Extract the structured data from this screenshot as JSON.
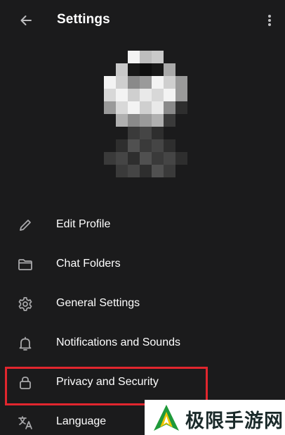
{
  "header": {
    "title": "Settings",
    "back_icon": "back-arrow-icon",
    "more_icon": "more-vertical-icon"
  },
  "profile": {
    "avatar": "pixelated-avatar"
  },
  "menu": {
    "items": [
      {
        "label": "Edit Profile",
        "icon": "pencil-icon"
      },
      {
        "label": "Chat Folders",
        "icon": "folder-icon"
      },
      {
        "label": "General Settings",
        "icon": "gear-icon"
      },
      {
        "label": "Notifications and Sounds",
        "icon": "bell-icon"
      },
      {
        "label": "Privacy and Security",
        "icon": "lock-icon",
        "highlighted": true
      },
      {
        "label": "Language",
        "icon": "translate-icon"
      }
    ]
  },
  "annotation": {
    "highlight_color": "#e1262e"
  },
  "watermark": {
    "text": "极限手游网",
    "logo_colors": [
      "#1f9a3a",
      "#f2c500"
    ]
  },
  "colors": {
    "background": "#1b1b1c",
    "text": "#ffffff",
    "icon": "#a9a9ab"
  }
}
